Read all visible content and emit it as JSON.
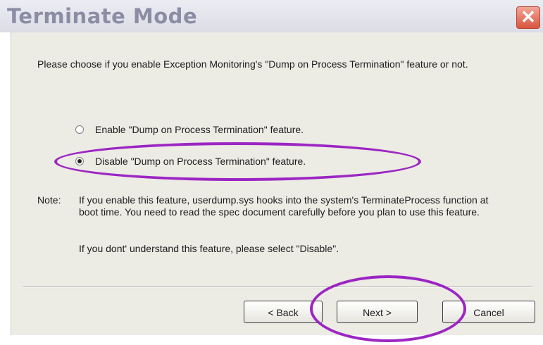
{
  "dialog": {
    "title": "Terminate Mode",
    "close_glyph": "✕",
    "intro": "Please choose if you enable Exception Monitoring's \"Dump on Process Termination\" feature or not.",
    "options": [
      {
        "label": "Enable \"Dump on Process Termination\" feature.",
        "selected": false
      },
      {
        "label": "Disable \"Dump on Process Termination\" feature.",
        "selected": true
      }
    ],
    "note_label": "Note:",
    "note_text": "If you enable this feature, userdump.sys hooks into the system's TerminateProcess function at boot time. You need to read the spec document carefully before you plan to use this feature.",
    "note_text2": "If you dont' understand this feature, please select \"Disable\".",
    "buttons": {
      "back": "< Back",
      "next": "Next >",
      "cancel": "Cancel"
    }
  },
  "colors": {
    "highlight": "#9c26c3",
    "title_text": "#8c8ca4",
    "close_button": "#d8563f"
  }
}
